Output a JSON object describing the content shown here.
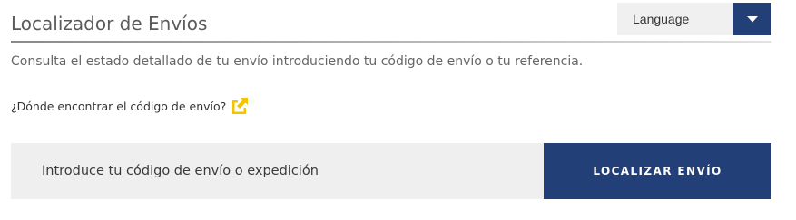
{
  "header": {
    "title": "Localizador de Envíos"
  },
  "language_selector": {
    "label": "Language",
    "caret_icon": "caret-down-icon"
  },
  "intro": {
    "text": "Consulta el estado detallado de tu envío introduciendo tu código de envío o tu referencia."
  },
  "help": {
    "link_text": "¿Dónde encontrar el código de envío?",
    "icon": "external-link-icon"
  },
  "search": {
    "placeholder": "Introduce tu código de envío o expedición",
    "value": "",
    "button_label": "LOCALIZAR ENVÍO"
  },
  "colors": {
    "brand_blue": "#233f78",
    "help_icon_yellow": "#f5c400",
    "input_background": "#efefef"
  }
}
